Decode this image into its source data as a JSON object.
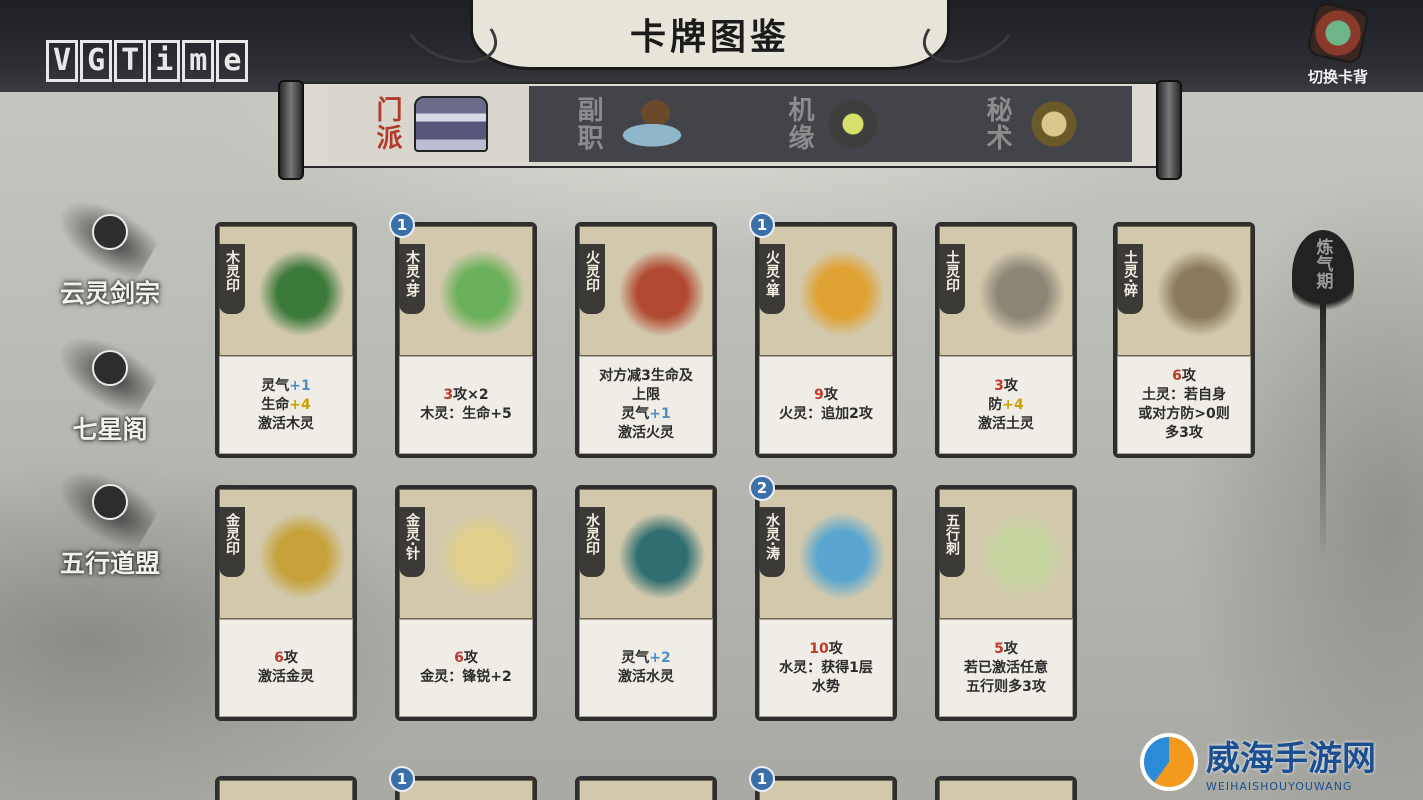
{
  "header": {
    "title": "卡牌图鉴",
    "logo_letters": [
      "V",
      "G",
      "T",
      "i",
      "m",
      "e"
    ],
    "card_back_label": "切换卡背"
  },
  "tabs": [
    {
      "label": "门派",
      "active": true,
      "icon": "gate-icon"
    },
    {
      "label": "副职",
      "active": false,
      "icon": "hat-icon"
    },
    {
      "label": "机缘",
      "active": false,
      "icon": "spirit-stone-icon"
    },
    {
      "label": "秘术",
      "active": false,
      "icon": "scroll-icon"
    }
  ],
  "sects": [
    {
      "name": "云灵剑宗",
      "icon": "cloud-emblem-icon"
    },
    {
      "name": "七星阁",
      "icon": "star-emblem-icon"
    },
    {
      "name": "五行道盟",
      "icon": "five-elements-emblem-icon"
    }
  ],
  "realm": "炼气期",
  "cards": [
    {
      "name": "木灵印",
      "cost": "",
      "art": "#3c7a3a",
      "lines": [
        [
          "灵气",
          "+1",
          "blue"
        ],
        [
          "生命",
          "+4",
          "yellow"
        ],
        [
          "激活木灵",
          "",
          ""
        ]
      ]
    },
    {
      "name": "木灵·芽",
      "cost": "1",
      "art": "#6bb05a",
      "lines": [
        [
          "",
          "3",
          "red",
          "攻×2"
        ],
        [
          "木灵：生命+5",
          "",
          ""
        ]
      ]
    },
    {
      "name": "火灵印",
      "cost": "",
      "art": "#b24a33",
      "lines": [
        [
          "对方减3生命及",
          "",
          ""
        ],
        [
          "上限",
          "",
          ""
        ],
        [
          "灵气",
          "+1",
          "blue"
        ],
        [
          "激活火灵",
          "",
          ""
        ]
      ]
    },
    {
      "name": "火灵·箪",
      "cost": "1",
      "art": "#e0a233",
      "lines": [
        [
          "",
          "9",
          "red",
          "攻"
        ],
        [
          "火灵：追加2攻",
          "",
          ""
        ]
      ]
    },
    {
      "name": "土灵印",
      "cost": "",
      "art": "#8c8676",
      "lines": [
        [
          "",
          "3",
          "red",
          "攻"
        ],
        [
          "防",
          "+4",
          "yellow"
        ],
        [
          "激活土灵",
          "",
          ""
        ]
      ]
    },
    {
      "name": "土灵·碎",
      "cost": "",
      "art": "#8a7a5a",
      "lines": [
        [
          "",
          "6",
          "red",
          "攻"
        ],
        [
          "土灵：若自身",
          "",
          ""
        ],
        [
          "或对方防>0则",
          "",
          ""
        ],
        [
          "多3攻",
          "",
          ""
        ]
      ]
    },
    {
      "name": "金灵印",
      "cost": "",
      "art": "#c7a23a",
      "lines": [
        [
          "",
          "6",
          "red",
          "攻"
        ],
        [
          "激活金灵",
          "",
          ""
        ]
      ]
    },
    {
      "name": "金灵·针",
      "cost": "",
      "art": "#e0cf8a",
      "lines": [
        [
          "",
          "6",
          "red",
          "攻"
        ],
        [
          "金灵：锋锐+2",
          "",
          ""
        ]
      ]
    },
    {
      "name": "水灵印",
      "cost": "",
      "art": "#2f6f72",
      "lines": [
        [
          "灵气",
          "+2",
          "blue"
        ],
        [
          "激活水灵",
          "",
          ""
        ]
      ]
    },
    {
      "name": "水灵·涛",
      "cost": "2",
      "art": "#5aa6d0",
      "lines": [
        [
          "",
          "10",
          "red",
          "攻"
        ],
        [
          "水灵：获得1层",
          "",
          ""
        ],
        [
          "水势",
          "",
          ""
        ]
      ]
    },
    {
      "name": "五行刺",
      "cost": "",
      "art": "#c7d6a0",
      "lines": [
        [
          "",
          "5",
          "red",
          "攻"
        ],
        [
          "若已激活任意",
          "",
          ""
        ],
        [
          "五行则多3攻",
          "",
          ""
        ]
      ]
    }
  ],
  "partial_cards": [
    {
      "cost": ""
    },
    {
      "cost": "1"
    },
    {
      "cost": ""
    },
    {
      "cost": "1"
    },
    {
      "cost": ""
    }
  ],
  "watermark": {
    "cn": "威海手游网",
    "en": "WEIHAISHOUYOUWANG"
  }
}
